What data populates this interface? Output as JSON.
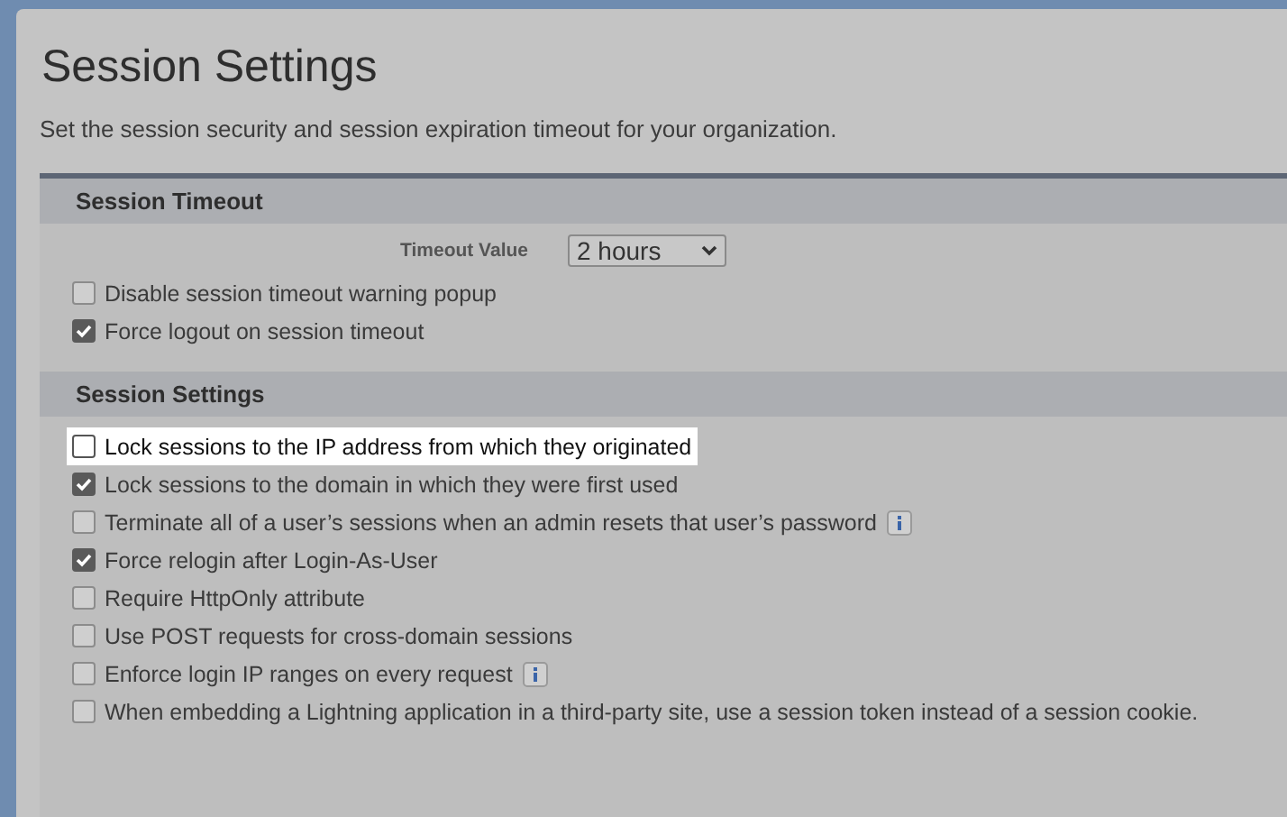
{
  "page": {
    "title": "Session Settings",
    "description": "Set the session security and session expiration timeout for your organization."
  },
  "sections": [
    {
      "title": "Session Timeout",
      "timeout": {
        "label": "Timeout Value",
        "value": "2 hours"
      },
      "options": [
        {
          "label": "Disable session timeout warning popup",
          "checked": false,
          "highlighted": false,
          "info": false
        },
        {
          "label": "Force logout on session timeout",
          "checked": true,
          "highlighted": false,
          "info": false
        }
      ]
    },
    {
      "title": "Session Settings",
      "options": [
        {
          "label": "Lock sessions to the IP address from which they originated",
          "checked": false,
          "highlighted": true,
          "info": false
        },
        {
          "label": "Lock sessions to the domain in which they were first used",
          "checked": true,
          "highlighted": false,
          "info": false
        },
        {
          "label": "Terminate all of a user’s sessions when an admin resets that user’s password",
          "checked": false,
          "highlighted": false,
          "info": true
        },
        {
          "label": "Force relogin after Login-As-User",
          "checked": true,
          "highlighted": false,
          "info": false
        },
        {
          "label": "Require HttpOnly attribute",
          "checked": false,
          "highlighted": false,
          "info": false
        },
        {
          "label": "Use POST requests for cross-domain sessions",
          "checked": false,
          "highlighted": false,
          "info": false
        },
        {
          "label": "Enforce login IP ranges on every request",
          "checked": false,
          "highlighted": false,
          "info": true
        },
        {
          "label": "When embedding a Lightning application in a third-party site, use a session token instead of a session cookie.",
          "checked": false,
          "highlighted": false,
          "info": false
        }
      ]
    }
  ]
}
